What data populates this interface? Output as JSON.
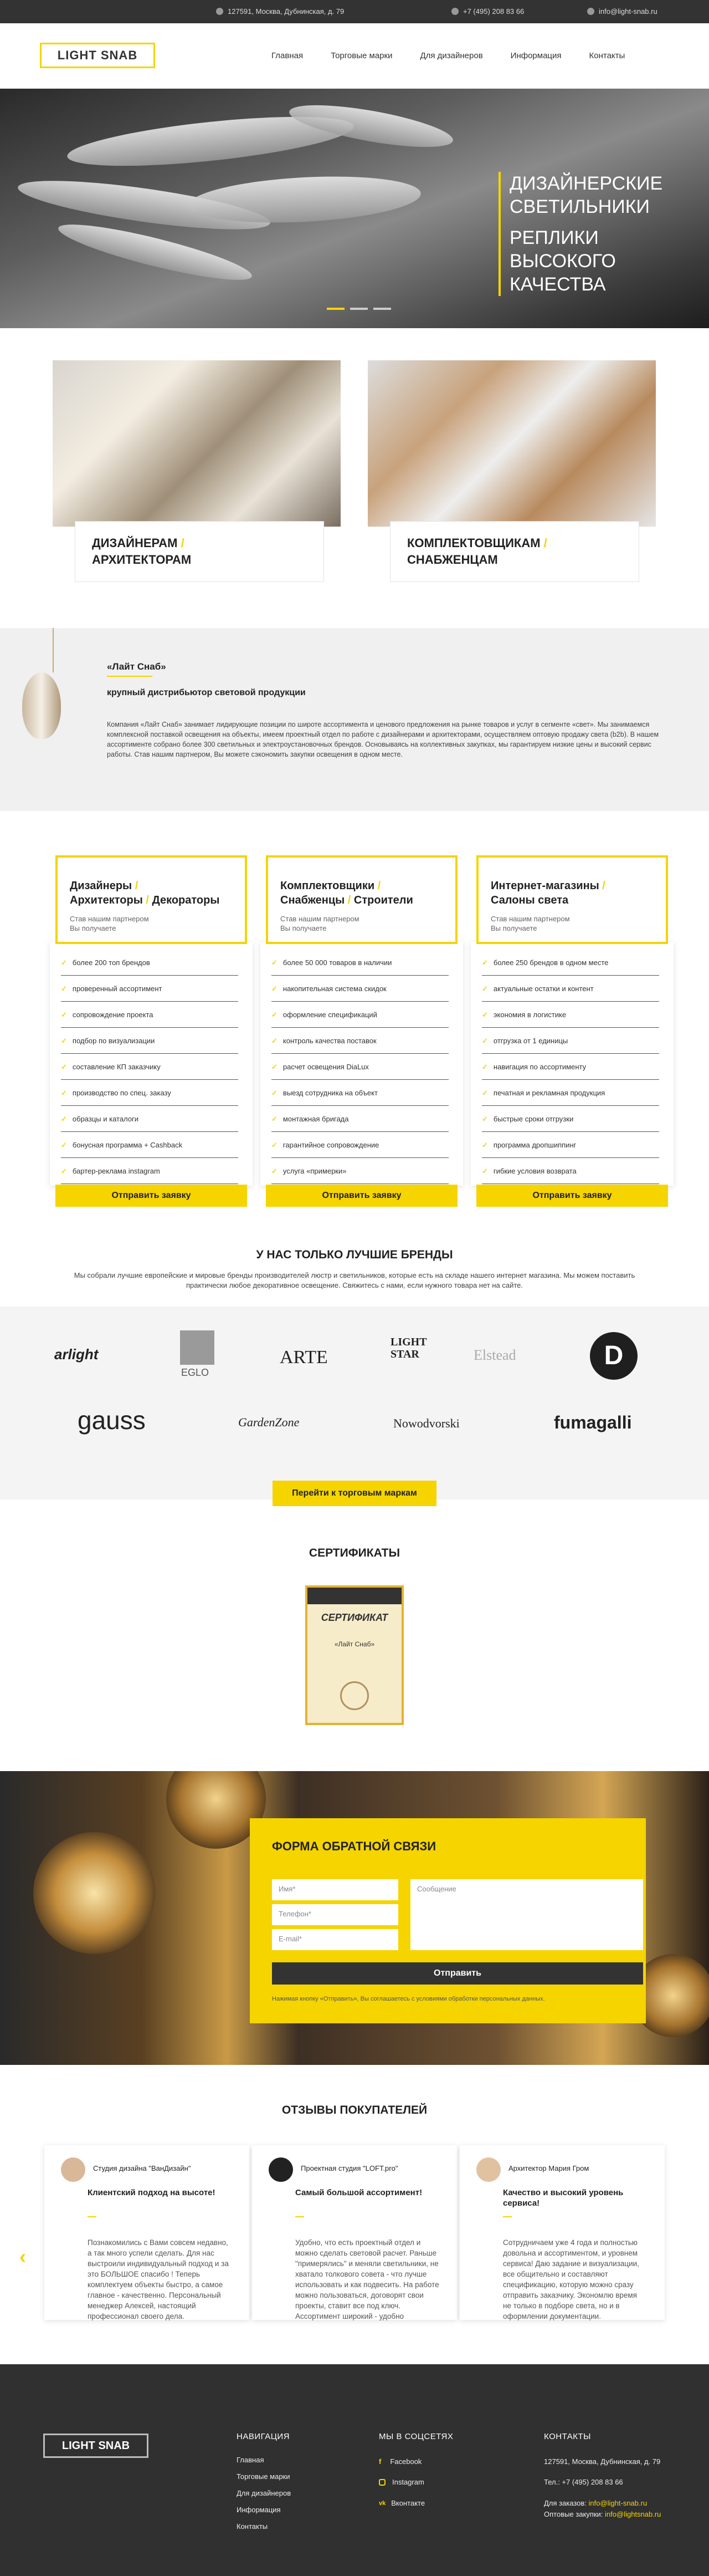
{
  "topbar": {
    "address": "127591, Москва, Дубнинская, д. 79",
    "phone": "+7 (495) 208 83 66",
    "email": "info@light-snab.ru"
  },
  "header": {
    "logo": "LIGHT SNAB",
    "nav": [
      "Главная",
      "Торговые марки",
      "Для дизайнеров",
      "Информация",
      "Контакты"
    ]
  },
  "hero": {
    "line1": "ДИЗАЙНЕРСКИЕ",
    "line2": "СВЕТИЛЬНИКИ",
    "line3": "РЕПЛИКИ",
    "line4": "ВЫСОКОГО",
    "line5": "КАЧЕСТВА"
  },
  "categories": [
    {
      "a": "ДИЗАЙНЕРАМ",
      "sep": " /",
      "b": "АРХИТЕКТОРАМ"
    },
    {
      "a": "КОМПЛЕКТОВЩИКАМ",
      "sep": " /",
      "b": "СНАБЖЕНЦАМ"
    }
  ],
  "about": {
    "title": "«Лайт Снаб»",
    "subtitle": "крупный дистрибьютор световой продукции",
    "text": "Компания «Лайт Снаб» занимает лидирующие позиции по широте ассортимента и ценового предложения на рынке товаров и услуг в сегменте «свет». Мы занимаемся комплексной поставкой освещения на объекты, имеем проектный отдел по работе с дизайнерами и архитекторами, осуществляем оптовую продажу света (b2b). В нашем ассортименте собрано более 300 светильных и электроустановочных брендов. Основываясь на коллективных закупках, мы гарантируем низкие цены и высокий сервис работы. Став нашим партнером, Вы можете сэкономить закупки освещения в одном месте."
  },
  "columns": [
    {
      "t1": "Дизайнеры",
      "t2": "Архитекторы",
      "t3": "Декораторы",
      "sub1": "Став нашим партнером",
      "sub2": "Вы получаете",
      "items": [
        "более 200 топ брендов",
        "проверенный ассортимент",
        "сопровождение проекта",
        "подбор по визуализации",
        "составление КП заказчику",
        "производство по спец. заказу",
        "образцы и каталоги",
        "бонусная программа + Cashback",
        "бартер-реклама instagram"
      ],
      "btn": "Отправить заявку"
    },
    {
      "t1": "Комплектовщики",
      "t2": "Снабженцы",
      "t3": "Строители",
      "sub1": "Став нашим партнером",
      "sub2": "Вы получаете",
      "items": [
        "более 50 000 товаров в наличии",
        "накопительная система скидок",
        "оформление спецификаций",
        "контроль качества поставок",
        "расчет освещения DiaLux",
        "выезд сотрудника на объект",
        "монтажная бригада",
        "гарантийное сопровождение",
        "услуга «примерки»"
      ],
      "btn": "Отправить заявку"
    },
    {
      "t1": "Интернет-магазины",
      "t2": "Салоны света",
      "t3": "",
      "sub1": "Став нашим партнером",
      "sub2": "Вы получаете",
      "items": [
        "более 250 брендов в одном месте",
        "актуальные остатки и контент",
        "экономия в логистике",
        "отгрузка от 1 единицы",
        "навигация по ассортименту",
        "печатная и рекламная продукция",
        "быстрые сроки отгрузки",
        "программа дропшиппинг",
        "гибкие условия возврата"
      ],
      "btn": "Отправить заявку"
    }
  ],
  "brands": {
    "title": "У НАС ТОЛЬКО ЛУЧШИЕ БРЕНДЫ",
    "desc": "Мы собрали лучшие европейские и мировые бренды производителей люстр и светильников, которые есть на складе нашего интернет магазина. Мы можем поставить практически любое декоративное освещение. Свяжитесь с нами, если нужного товара нет на сайте.",
    "logos": [
      "arlight",
      "EGLO",
      "ARTE",
      "LIGHT STAR",
      "Elstead",
      "D",
      "gauss",
      "GardenZone",
      "Nowodvorski",
      "fumagalli"
    ],
    "button": "Перейти к торговым маркам"
  },
  "certs": {
    "title": "СЕРТИФИКАТЫ",
    "cert_heading": "СЕРТИФИКАТ",
    "cert_name": "«Лайт Снаб»"
  },
  "form": {
    "title": "ФОРМА ОБРАТНОЙ СВЯЗИ",
    "name": "Имя*",
    "phone": "Телефон*",
    "email": "E-mail*",
    "message": "Сообщение",
    "send": "Отправить",
    "note": "Нажимая кнопку «Отправить», Вы соглашаетесь с условиями обработки персональных данных."
  },
  "reviews": {
    "title": "ОТЗЫВЫ ПОКУПАТЕЛЕЙ",
    "items": [
      {
        "name": "Студия дизайна \"ВанДизайн\"",
        "head": "Клиентский подход на высоте!",
        "text": "Познакомились с Вами совсем недавно, а так много успели сделать. Для нас выстроили индивидуальный подход и за это БОЛЬШОЕ спасибо ! Теперь комплектуем объекты быстро, а самое главное - качественно. Персональный менеджер Алексей, настоящий профессионал своего дела."
      },
      {
        "name": "Проектная студия \"LOFT.pro\"",
        "head": "Самый большой ассортимент!",
        "text": "Удобно, что есть проектный отдел и можно сделать световой расчет. Раньше \"примерялись\" и меняли светильники, не хватало толкового совета - что лучше использовать и как подвесить. На работе можно пользоваться, договорят свои проекты, ставит все под ключ. Ассортимент широкий - удобно"
      },
      {
        "name": "Архитектор Мария Гром",
        "head": "Качество и высокий уровень сервиса!",
        "text": "Сотрудничаем уже 4 года и полностью довольна и ассортиментом, и уровнем сервиса! Даю задание и визуализации, все общительно и составляют спецификацию, которую можно сразу отправить заказчику. Экономлю время не только в подборе света, но и в оформлении документации."
      }
    ]
  },
  "footer": {
    "logo": "LIGHT SNAB",
    "nav_title": "НАВИГАЦИЯ",
    "nav": [
      "Главная",
      "Торговые марки",
      "Для дизайнеров",
      "Информация",
      "Контакты"
    ],
    "social_title": "МЫ В СОЦСЕТЯХ",
    "social": [
      "Facebook",
      "Instagram",
      "Вконтакте"
    ],
    "contacts_title": "КОНТАКТЫ",
    "address": "127591, Москва, Дубнинская, д. 79",
    "phone": "Тел.: +7 (495) 208 83 66",
    "orders_label": "Для заказов:",
    "orders_email": "info@light-snab.ru",
    "wholesale_label": "Оптовые закупки:",
    "wholesale_email": "info@lightsnab.ru"
  },
  "colors": {
    "accent": "#f5d400",
    "dark": "#303030"
  }
}
